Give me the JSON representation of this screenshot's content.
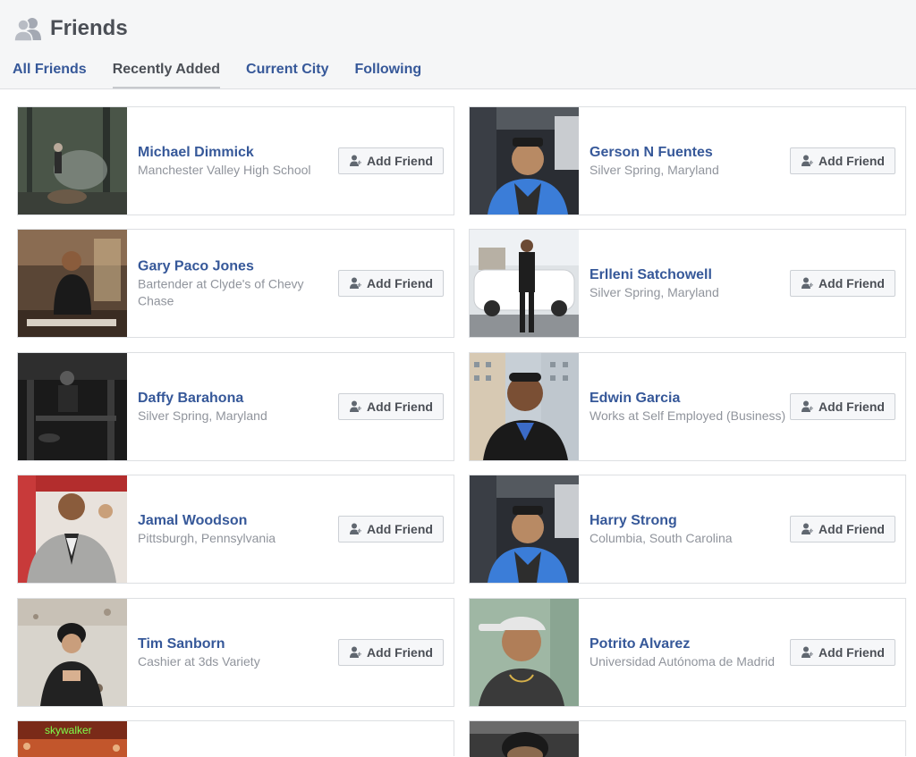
{
  "header": {
    "title": "Friends",
    "tabs": [
      {
        "label": "All Friends",
        "active": false
      },
      {
        "label": "Recently Added",
        "active": true
      },
      {
        "label": "Current City",
        "active": false
      },
      {
        "label": "Following",
        "active": false
      }
    ]
  },
  "add_friend_label": "Add Friend",
  "friends": [
    {
      "name": "Michael Dimmick",
      "subtitle": "Manchester Valley High School",
      "photo_icon": "forest-photo"
    },
    {
      "name": "Gerson N Fuentes",
      "subtitle": "Silver Spring, Maryland",
      "photo_icon": "car-selfie-photo"
    },
    {
      "name": "Gary Paco Jones",
      "subtitle": "Bartender at Clyde's of Chevy Chase",
      "photo_icon": "bar-photo"
    },
    {
      "name": "Erlleni Satchowell",
      "subtitle": "Silver Spring, Maryland",
      "photo_icon": "parking-lot-photo"
    },
    {
      "name": "Daffy Barahona",
      "subtitle": "Silver Spring, Maryland",
      "photo_icon": "dark-lounge-photo"
    },
    {
      "name": "Edwin Garcia",
      "subtitle": "Works at Self Employed (Business)",
      "photo_icon": "city-portrait-photo"
    },
    {
      "name": "Jamal Woodson",
      "subtitle": "Pittsburgh, Pennsylvania",
      "photo_icon": "suit-portrait-photo"
    },
    {
      "name": "Harry Strong",
      "subtitle": "Columbia, South Carolina",
      "photo_icon": "car-selfie-photo"
    },
    {
      "name": "Tim Sanborn",
      "subtitle": "Cashier at 3ds Variety",
      "photo_icon": "snow-photo"
    },
    {
      "name": "Potrito Alvarez",
      "subtitle": "Universidad Autónoma de Madrid",
      "photo_icon": "cap-portrait-photo"
    }
  ],
  "partial_row": {
    "left_photo_text": "skywalker",
    "left_photo_icon": "neon-sign-photo",
    "right_photo_icon": "portrait-photo"
  },
  "colors": {
    "link_blue": "#365899",
    "secondary_text": "#90949c",
    "header_bg": "#f5f6f7",
    "border": "#dddfe2"
  }
}
